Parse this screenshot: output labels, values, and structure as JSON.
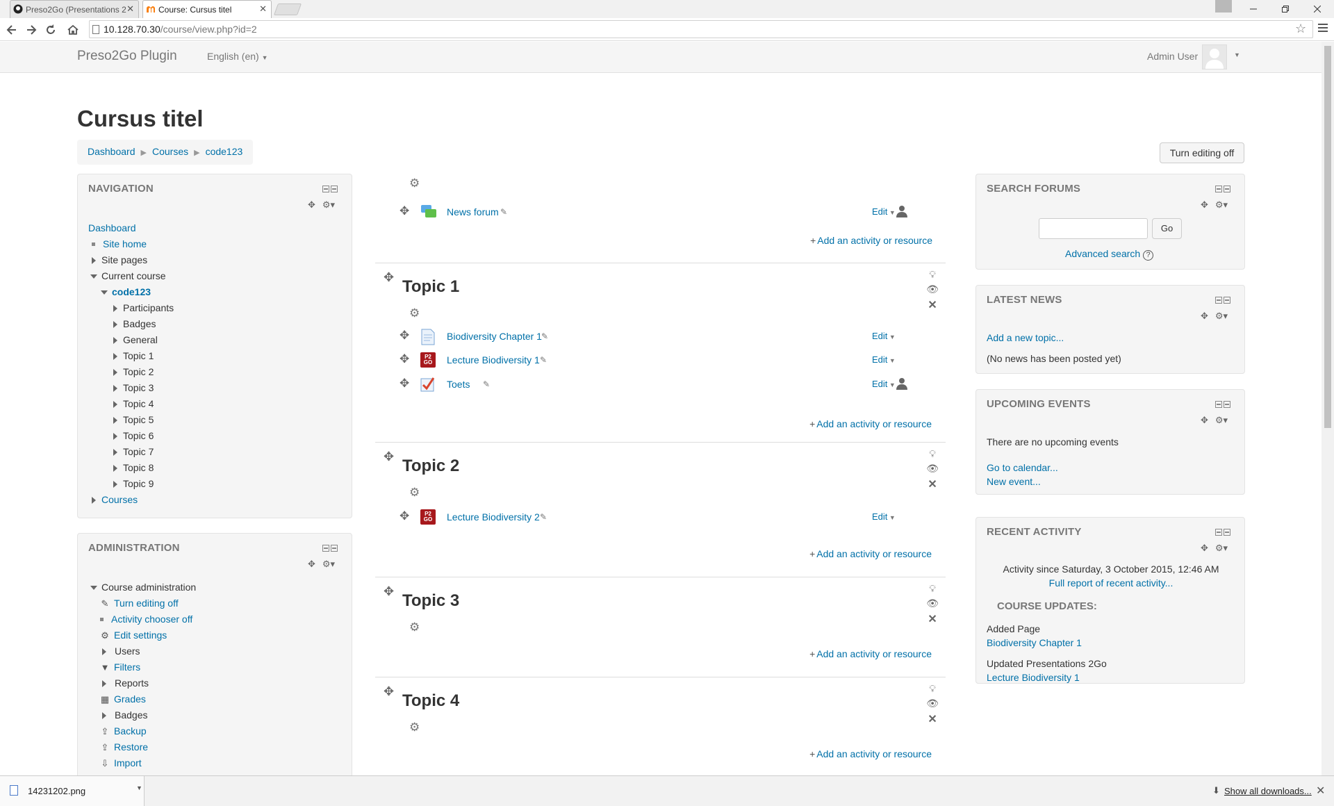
{
  "browser": {
    "tabs": [
      {
        "label": "Preso2Go (Presentations 2",
        "active": false
      },
      {
        "label": "Course: Cursus titel",
        "active": true
      }
    ],
    "url_host": "10.128.70.30",
    "url_path": "/course/view.php?id=2"
  },
  "navbar": {
    "brand": "Preso2Go Plugin",
    "language": "English (en)",
    "user": "Admin User"
  },
  "page": {
    "title": "Cursus titel",
    "breadcrumb": [
      "Dashboard",
      "Courses",
      "code123"
    ],
    "editing_button": "Turn editing off"
  },
  "navigation_block": {
    "title": "NAVIGATION",
    "dashboard": "Dashboard",
    "site_home": "Site home",
    "site_pages": "Site pages",
    "current_course": "Current course",
    "course_code": "code123",
    "course_items": [
      "Participants",
      "Badges",
      "General",
      "Topic 1",
      "Topic 2",
      "Topic 3",
      "Topic 4",
      "Topic 5",
      "Topic 6",
      "Topic 7",
      "Topic 8",
      "Topic 9"
    ],
    "courses": "Courses"
  },
  "admin_block": {
    "title": "ADMINISTRATION",
    "course_admin": "Course administration",
    "items": [
      "Turn editing off",
      "Activity chooser off",
      "Edit settings",
      "Users",
      "Filters",
      "Reports",
      "Grades",
      "Badges",
      "Backup",
      "Restore",
      "Import"
    ]
  },
  "course": {
    "edit_label": "Edit",
    "add_activity": "Add an activity or resource",
    "general": {
      "activities": [
        "News forum"
      ]
    },
    "topics": [
      {
        "title": "Topic 1",
        "activities": [
          "Biodiversity Chapter 1",
          "Lecture Biodiversity 1",
          "Toets"
        ]
      },
      {
        "title": "Topic 2",
        "activities": [
          "Lecture Biodiversity 2"
        ]
      },
      {
        "title": "Topic 3",
        "activities": []
      },
      {
        "title": "Topic 4",
        "activities": []
      }
    ]
  },
  "search_forums": {
    "title": "SEARCH FORUMS",
    "go": "Go",
    "advanced": "Advanced search"
  },
  "latest_news": {
    "title": "LATEST NEWS",
    "add": "Add a new topic...",
    "empty": "(No news has been posted yet)"
  },
  "upcoming": {
    "title": "UPCOMING EVENTS",
    "empty": "There are no upcoming events",
    "calendar": "Go to calendar...",
    "new_event": "New event..."
  },
  "recent": {
    "title": "RECENT ACTIVITY",
    "since": "Activity since Saturday, 3 October 2015, 12:46 AM",
    "full_report": "Full report of recent activity...",
    "updates_title": "COURSE UPDATES:",
    "u1_label": "Added Page",
    "u1_link": "Biodiversity Chapter 1",
    "u2_label": "Updated Presentations 2Go",
    "u2_link": "Lecture Biodiversity 1"
  },
  "downloads": {
    "file": "14231202.png",
    "show_all": "Show all downloads..."
  },
  "icons": [
    "github-icon",
    "moodle-icon",
    "move-icon",
    "gear-icon",
    "pencil-icon",
    "eye-icon",
    "lightbulb-icon",
    "delete-icon",
    "person-icon",
    "forum-icon",
    "page-icon",
    "preso2go-icon",
    "quiz-icon",
    "help-icon"
  ],
  "colors": {
    "link": "#0070a8",
    "preso_brand": "#a7181c"
  }
}
